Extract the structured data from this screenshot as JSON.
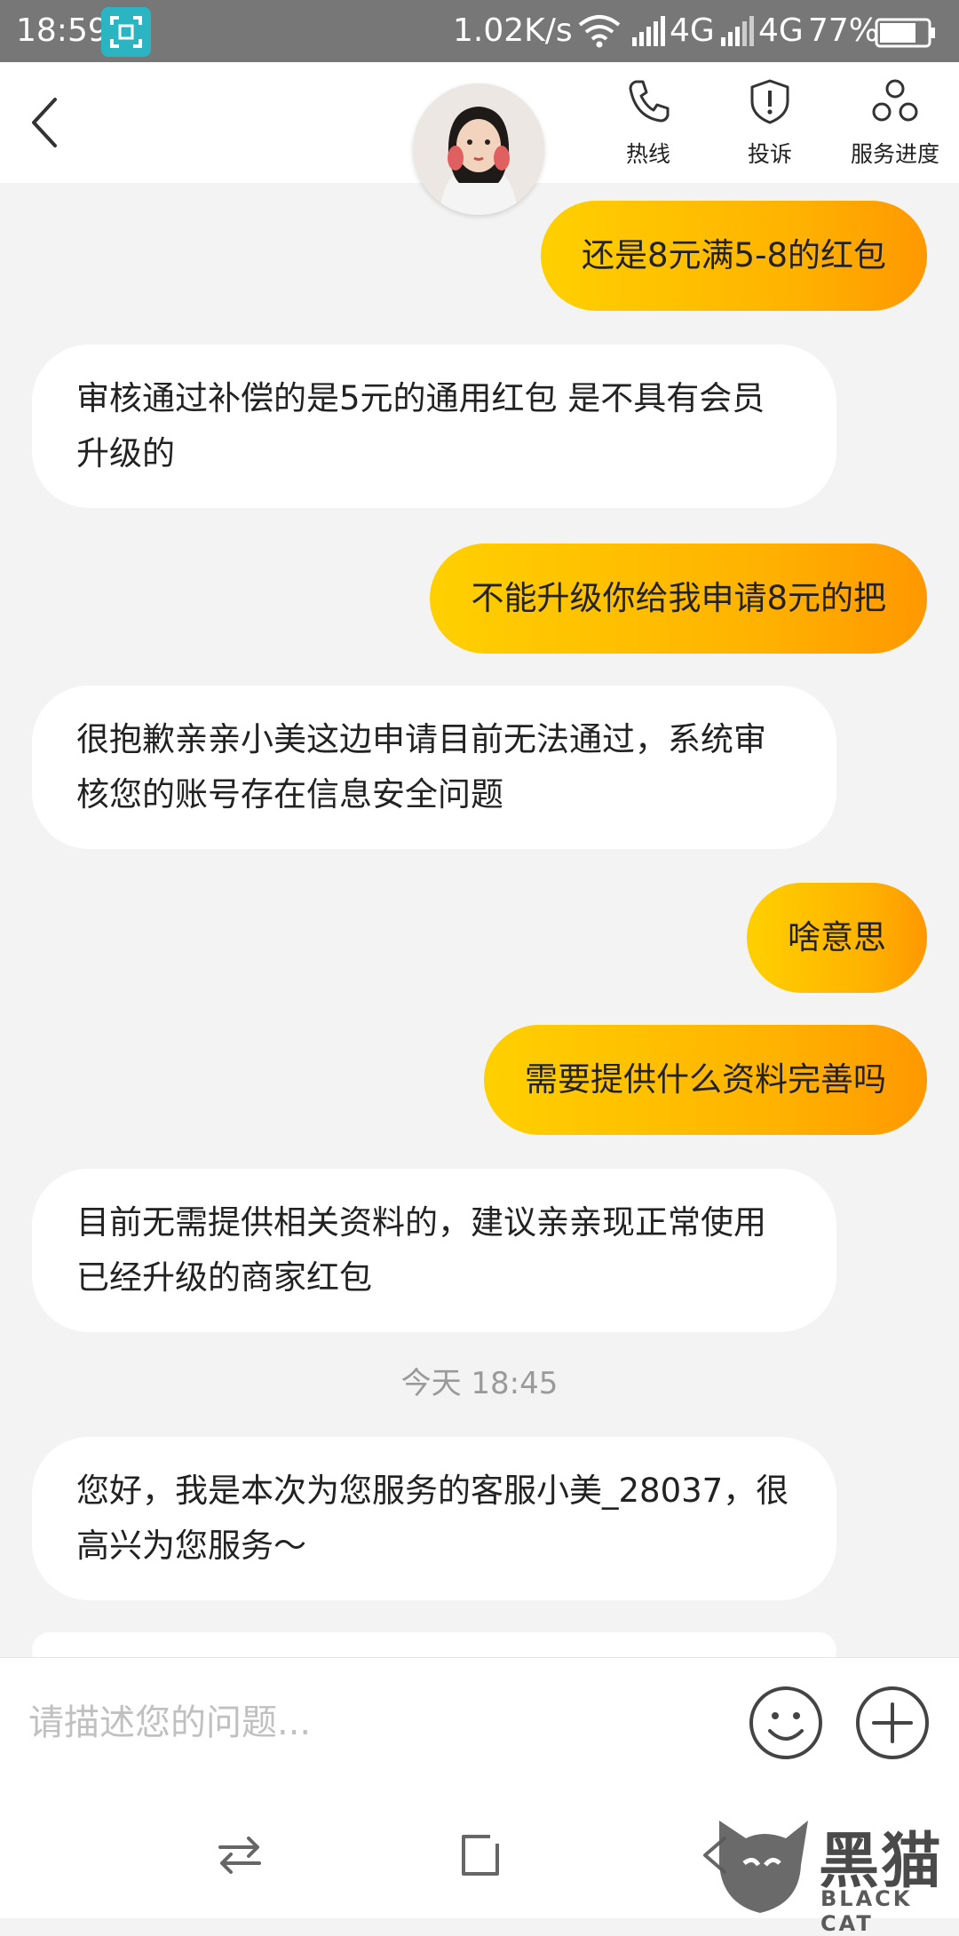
{
  "status_bar": {
    "time": "18:59",
    "speed": "1.02K/s",
    "network1": "4G",
    "network2": "4G",
    "battery": "77%"
  },
  "header": {
    "hotline_label": "热线",
    "complain_label": "投诉",
    "progress_label": "服务进度"
  },
  "messages": [
    {
      "from": "user",
      "text": "还是8元满5-8的红包"
    },
    {
      "from": "agent",
      "text": "审核通过补偿的是5元的通用红包 是不具有会员升级的"
    },
    {
      "from": "user",
      "text": "不能升级你给我申请8元的把"
    },
    {
      "from": "agent",
      "text": "很抱歉亲亲小美这边申请目前无法通过，系统审核您的账号存在信息安全问题"
    },
    {
      "from": "user",
      "text": "啥意思"
    },
    {
      "from": "user",
      "text": "需要提供什么资料完善吗"
    },
    {
      "from": "agent",
      "text": "目前无需提供相关资料的，建议亲亲现正常使用已经升级的商家红包"
    },
    {
      "from": "agent",
      "text": "您好，我是本次为您服务的客服小美_28037，很高兴为您服务～"
    }
  ],
  "timestamp": "今天 18:45",
  "input": {
    "placeholder": "请描述您的问题..."
  },
  "watermark": {
    "cn": "黑猫",
    "en": "BLACK CAT"
  },
  "colors": {
    "user_bubble_start": "#ffd000",
    "user_bubble_end": "#ff9800",
    "agent_bubble": "#ffffff",
    "status_bar": "#777777"
  }
}
